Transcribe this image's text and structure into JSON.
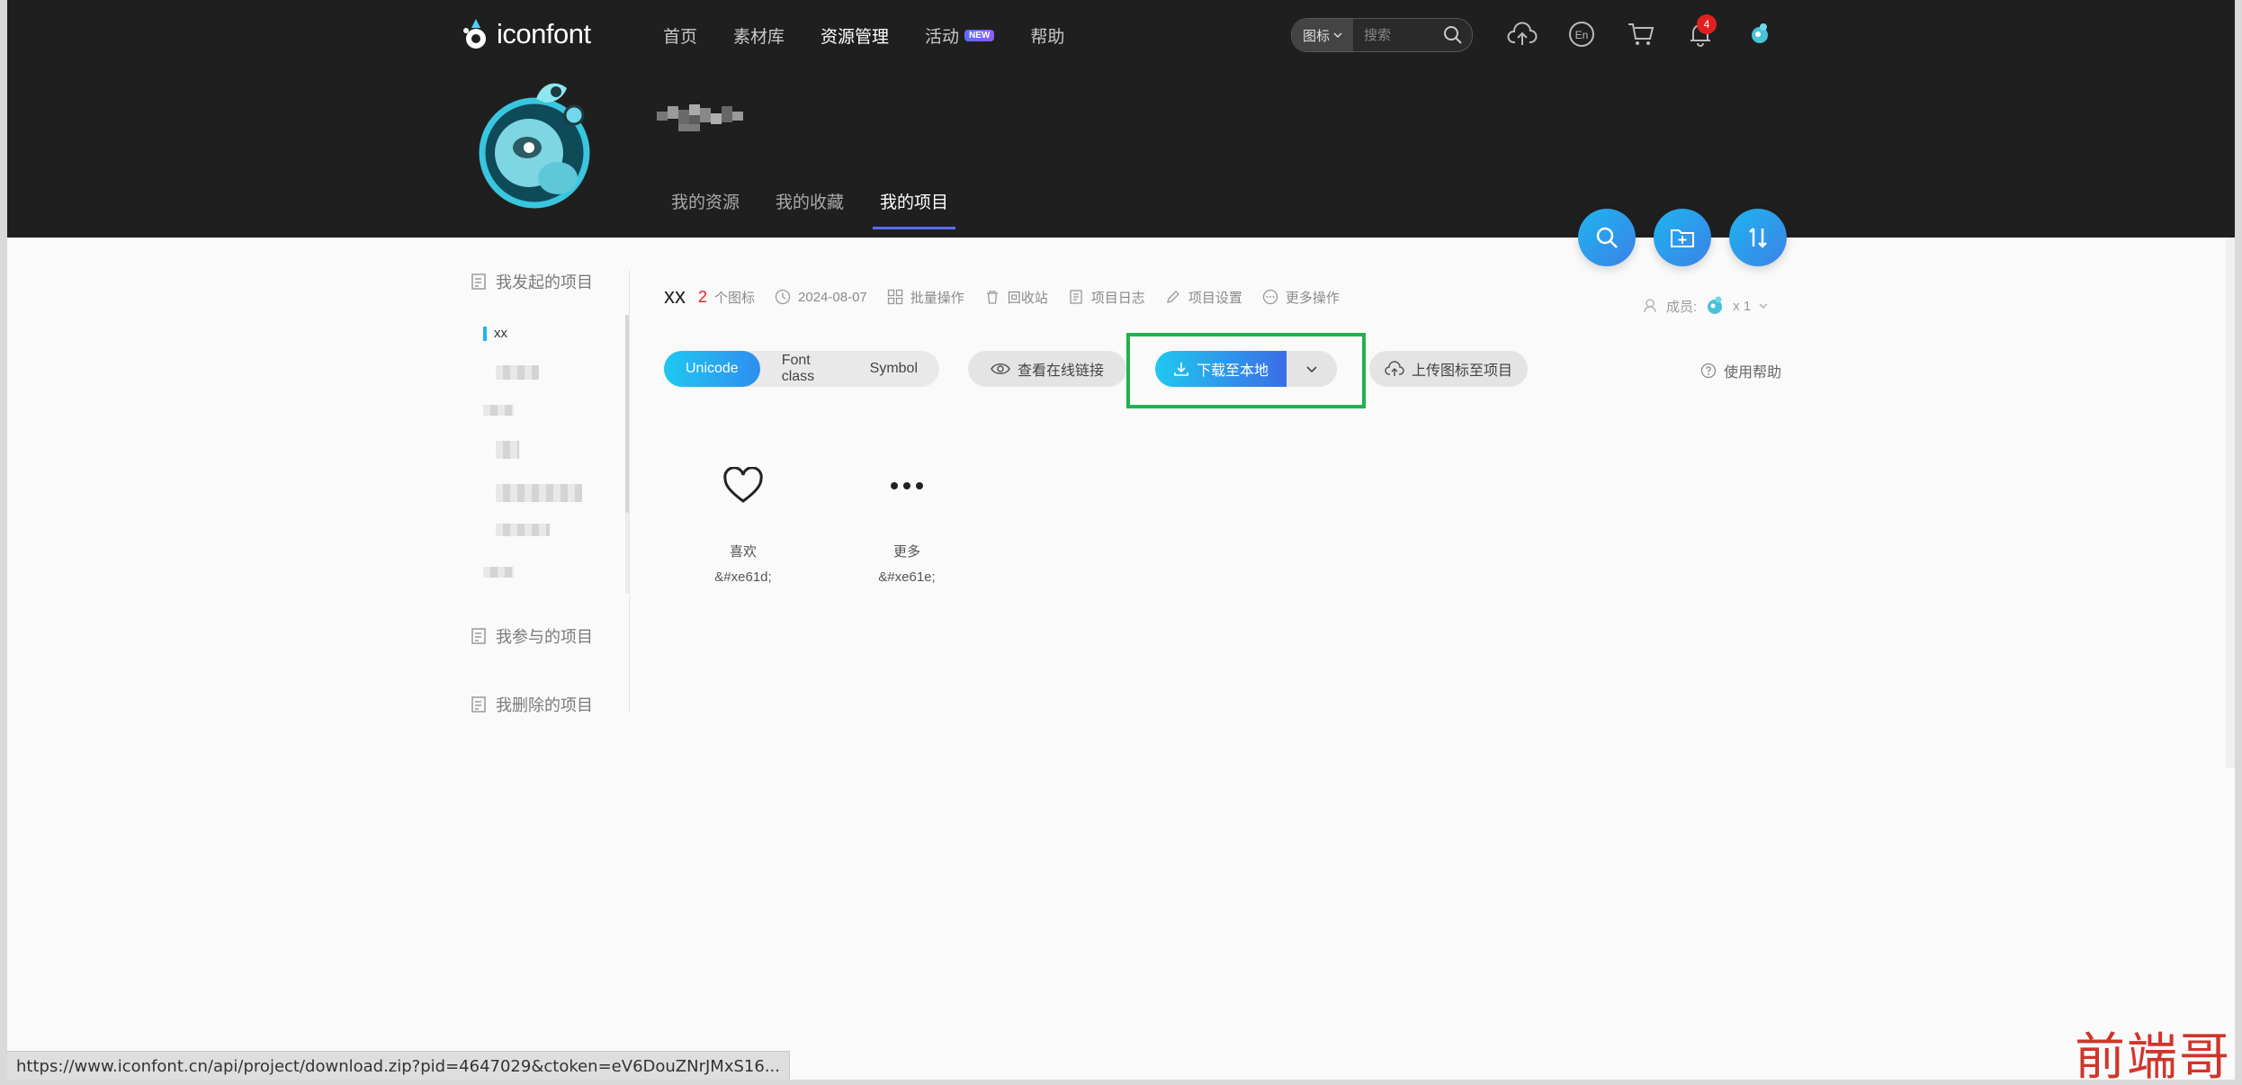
{
  "header": {
    "logo_text": "iconfont",
    "nav": [
      {
        "label": "首页"
      },
      {
        "label": "素材库"
      },
      {
        "label": "资源管理"
      },
      {
        "label": "活动",
        "badge": "NEW"
      },
      {
        "label": "帮助"
      }
    ],
    "search": {
      "type": "图标",
      "placeholder": "搜索"
    },
    "notification_count": "4"
  },
  "profile_tabs": [
    {
      "label": "我的资源"
    },
    {
      "label": "我的收藏"
    },
    {
      "label": "我的项目"
    }
  ],
  "sidebar": {
    "created": "我发起的项目",
    "active_project": "xx",
    "joined": "我参与的项目",
    "deleted": "我删除的项目"
  },
  "project": {
    "name": "xx",
    "icon_count": "2",
    "icon_count_label": "个图标",
    "date": "2024-08-07",
    "actions": [
      "批量操作",
      "回收站",
      "项目日志",
      "项目设置",
      "更多操作"
    ],
    "members_label": "成员:",
    "members_count": "x 1"
  },
  "toolbar": {
    "formats": [
      "Unicode",
      "Font class",
      "Symbol"
    ],
    "view_online": "查看在线链接",
    "download": "下载至本地",
    "upload": "上传图标至项目",
    "help": "使用帮助"
  },
  "icons": [
    {
      "name": "喜欢",
      "code": "&#xe61d;",
      "icon": "heart-icon"
    },
    {
      "name": "更多",
      "code": "&#xe61e;",
      "icon": "more-icon"
    }
  ],
  "status_url": "https://www.iconfont.cn/api/project/download.zip?pid=4647029&ctoken=eV6DouZNrJMxS16...",
  "watermark": "前端哥",
  "colors": {
    "accent": "#1fb4f0",
    "highlight_box": "#22b14c",
    "count_red": "#e02020"
  }
}
